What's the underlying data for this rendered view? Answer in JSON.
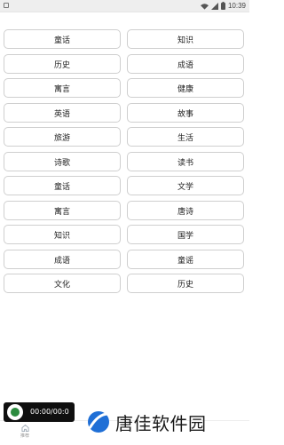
{
  "status_bar": {
    "time": "10:39",
    "battery_icon": "battery-icon",
    "wifi_icon": "wifi-icon"
  },
  "grid": {
    "rows": [
      [
        "童话",
        "知识"
      ],
      [
        "历史",
        "成语"
      ],
      [
        "寓言",
        "健康"
      ],
      [
        "英语",
        "故事"
      ],
      [
        "旅游",
        "生活"
      ],
      [
        "诗歌",
        "读书"
      ],
      [
        "童话",
        "文学"
      ],
      [
        "寓言",
        "唐诗"
      ],
      [
        "知识",
        "国学"
      ],
      [
        "成语",
        "童谣"
      ],
      [
        "文化",
        "历史"
      ]
    ]
  },
  "player": {
    "time": "00:00/00:0"
  },
  "tabbar": {
    "tabs": [
      {
        "label": "推荐",
        "icon": "home-icon"
      }
    ]
  },
  "watermark": {
    "text": "唐佳软件园"
  }
}
